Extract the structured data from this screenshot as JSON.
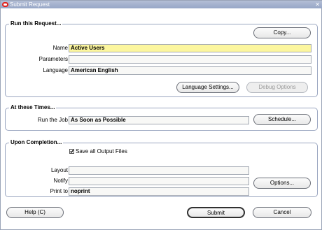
{
  "window": {
    "title": "Submit Request",
    "close_glyph": "✕"
  },
  "run_request": {
    "heading": "Run this Request...",
    "copy_button": "Copy...",
    "name": {
      "label": "Name",
      "value": "Active Users"
    },
    "parameters": {
      "label": "Parameters",
      "value": ""
    },
    "language": {
      "label": "Language",
      "value": "American English"
    },
    "language_settings_button": "Language Settings...",
    "debug_options_button": "Debug Options"
  },
  "schedule": {
    "heading": "At these Times...",
    "run_job": {
      "label": "Run the Job",
      "value": "As Soon as Possible"
    },
    "schedule_button": "Schedule..."
  },
  "completion": {
    "heading": "Upon Completion...",
    "save_output": {
      "label": "Save all Output Files",
      "checked": true
    },
    "layout": {
      "label": "Layout",
      "value": ""
    },
    "notify": {
      "label": "Notify",
      "value": ""
    },
    "print_to": {
      "label": "Print to",
      "value": "noprint"
    },
    "options_button": "Options..."
  },
  "footer": {
    "help_button": "Help (C)",
    "submit_button": "Submit",
    "cancel_button": "Cancel"
  },
  "colors": {
    "titlebar": "#a8b5d0",
    "active_field": "#fcf69e",
    "group_border": "#9aa6c0"
  }
}
